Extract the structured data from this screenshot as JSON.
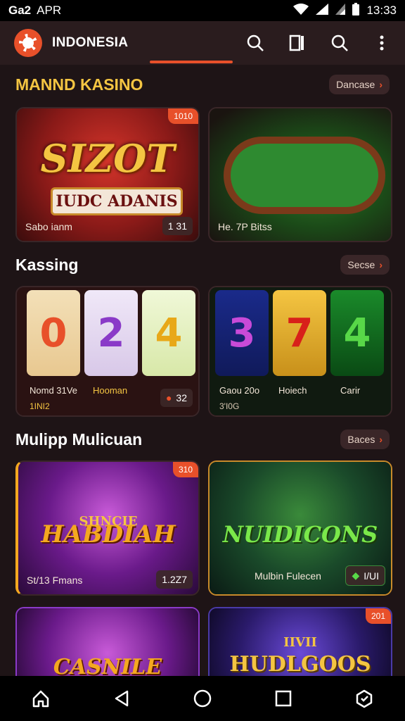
{
  "status": {
    "left_icon": "Ga2",
    "carrier": "APR",
    "time": "13:33",
    "icons": [
      "wifi-icon",
      "signal-icon",
      "battery-icon"
    ]
  },
  "appbar": {
    "title": "INDONESIA",
    "actions": [
      "search-icon",
      "book-icon",
      "search-icon",
      "more-icon"
    ]
  },
  "sections": [
    {
      "title": "MANND KASINO",
      "see": "Dancase",
      "cards": [
        {
          "title": "SIZOT",
          "subtitle": "IUDC ADANIS",
          "label": "Sabo ianm",
          "pill": "1  31",
          "badge": "1010"
        },
        {
          "label": "He. 7P Bitss"
        }
      ]
    },
    {
      "title": "Kassing",
      "see": "Secse",
      "cards": [
        {
          "reels": [
            "0",
            "2",
            "4"
          ],
          "label": "Nomd 31Ve",
          "label_extra": "Hooman",
          "sub": "1INI2",
          "pill": "32"
        },
        {
          "reels": [
            "3",
            "7",
            "4"
          ],
          "label": "Gaou 20o",
          "label_extra": "Hoiech",
          "label_extra2": "Carir",
          "sub": "3'I0G"
        }
      ]
    },
    {
      "title": "Mulipp Mulicuan",
      "see": "Baces",
      "cards": [
        {
          "title": "HABDIAH",
          "kicker": "SHNCIE",
          "label": "St/13 Fmans",
          "pill": "1.2Z7",
          "badge": "310"
        },
        {
          "title": "NUIDICONS",
          "label": "Mulbin Fulecen",
          "pill": "I/UI"
        }
      ]
    },
    {
      "cards": [
        {
          "title": "CASNILE"
        },
        {
          "title": "HUDLGOOS",
          "kicker": "IIVII",
          "badge": "201"
        }
      ]
    }
  ],
  "colors": {
    "accent": "#e8502a",
    "bg": "#1e1416",
    "gold": "#f4c542"
  }
}
